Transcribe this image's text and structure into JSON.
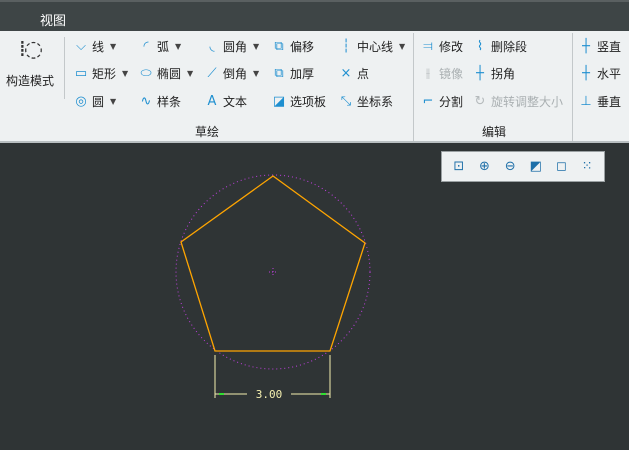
{
  "menu": {
    "view_tab": "视图"
  },
  "ribbon": {
    "construct_mode": "构造模式",
    "sketch": {
      "label": "草绘",
      "items": [
        {
          "label": "线",
          "icon": "line-icon",
          "dropdown": true
        },
        {
          "label": "弧",
          "icon": "arc-icon",
          "dropdown": true
        },
        {
          "label": "圆角",
          "icon": "fillet-icon",
          "dropdown": true
        },
        {
          "label": "偏移",
          "icon": "offset-icon"
        },
        {
          "label": "中心线",
          "icon": "centerline-icon",
          "dropdown": true
        },
        {
          "label": "矩形",
          "icon": "rectangle-icon",
          "dropdown": true
        },
        {
          "label": "椭圆",
          "icon": "ellipse-icon",
          "dropdown": true
        },
        {
          "label": "倒角",
          "icon": "chamfer-icon",
          "dropdown": true
        },
        {
          "label": "加厚",
          "icon": "thicken-icon"
        },
        {
          "label": "点",
          "icon": "point-icon"
        },
        {
          "label": "圆",
          "icon": "circle-icon",
          "dropdown": true
        },
        {
          "label": "样条",
          "icon": "spline-icon"
        },
        {
          "label": "文本",
          "icon": "text-icon"
        },
        {
          "label": "选项板",
          "icon": "palette-icon"
        },
        {
          "label": "坐标系",
          "icon": "coordinate-system-icon"
        }
      ]
    },
    "edit": {
      "label": "编辑",
      "items": [
        {
          "label": "修改",
          "icon": "modify-icon"
        },
        {
          "label": "删除段",
          "icon": "delete-segment-icon"
        },
        {
          "label": "镜像",
          "icon": "mirror-icon",
          "disabled": true
        },
        {
          "label": "拐角",
          "icon": "corner-icon"
        },
        {
          "label": "分割",
          "icon": "divide-icon"
        },
        {
          "label": "旋转调整大小",
          "icon": "rotate-resize-icon",
          "disabled": true
        }
      ]
    },
    "constrain": {
      "items": [
        {
          "label": "竖直",
          "icon": "vertical-icon"
        },
        {
          "label": "水平",
          "icon": "horizontal-icon"
        },
        {
          "label": "垂直",
          "icon": "perpendicular-icon"
        }
      ]
    }
  },
  "sketch": {
    "dimension": "3.00",
    "colors": {
      "geometry": "#ffa500",
      "construction": "#c040e0",
      "dimension": "#f5f0b0"
    }
  }
}
